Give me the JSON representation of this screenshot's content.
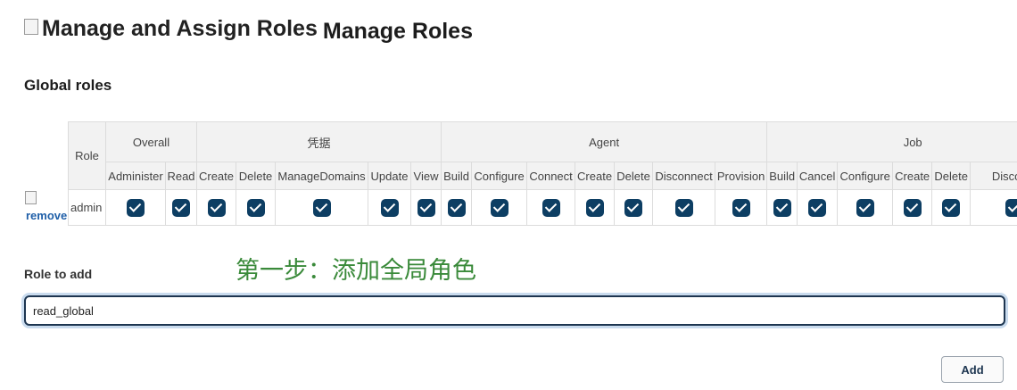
{
  "header": {
    "image_alt": "Manage and Assign Roles",
    "title": "Manage Roles"
  },
  "global_roles": {
    "section_title": "Global roles",
    "role_header": "Role",
    "groups": [
      {
        "label": "Overall",
        "perms": [
          "Administer",
          "Read"
        ]
      },
      {
        "label": "凭据",
        "perms": [
          "Create",
          "Delete",
          "ManageDomains",
          "Update",
          "View"
        ]
      },
      {
        "label": "Agent",
        "perms": [
          "Build",
          "Configure",
          "Connect",
          "Create",
          "Delete",
          "Disconnect",
          "Provision"
        ]
      },
      {
        "label": "Job",
        "perms": [
          "Build",
          "Cancel",
          "Configure",
          "Create",
          "Delete",
          "Discover"
        ]
      }
    ],
    "rows": [
      {
        "role": "admin",
        "remove_label": "remove",
        "checked": [
          true,
          true,
          true,
          true,
          true,
          true,
          true,
          true,
          true,
          true,
          true,
          true,
          true,
          true,
          true,
          true,
          true,
          true,
          true,
          true
        ]
      }
    ]
  },
  "annotation": "第一步：添加全局角色",
  "add_role": {
    "label": "Role to add",
    "value": "read_global",
    "button_label": "Add"
  }
}
